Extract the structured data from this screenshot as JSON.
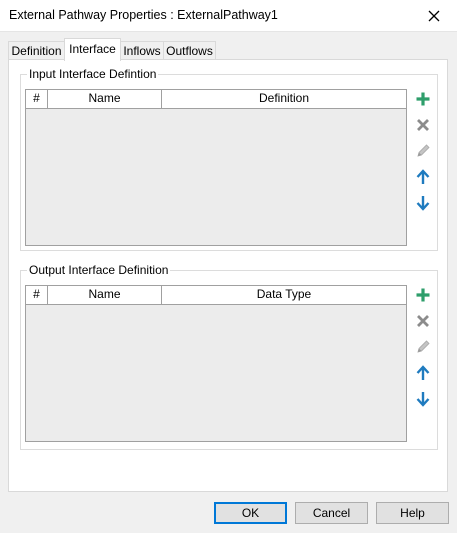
{
  "window": {
    "title": "External Pathway Properties : ExternalPathway1"
  },
  "tabs": [
    {
      "label": "Definition"
    },
    {
      "label": "Interface",
      "active": true
    },
    {
      "label": "Inflows"
    },
    {
      "label": "Outflows"
    }
  ],
  "input_group": {
    "legend": "Input Interface Defintion",
    "columns": [
      "#",
      "Name",
      "Definition"
    ],
    "rows": []
  },
  "output_group": {
    "legend": "Output Interface Definition",
    "columns": [
      "#",
      "Name",
      "Data Type"
    ],
    "rows": []
  },
  "side_buttons": {
    "icons": [
      "plus-icon",
      "delete-x-icon",
      "edit-pencil-icon",
      "arrow-up-icon",
      "arrow-down-icon"
    ],
    "colors": {
      "add": "#2e9e6b",
      "delete": "#8c8c8c",
      "edit": "#b0b0b0",
      "move": "#1f7bbf"
    }
  },
  "footer": {
    "ok_label": "OK",
    "cancel_label": "Cancel",
    "help_label": "Help"
  },
  "colors": {
    "accent": "#0078d7",
    "grid_bg": "#ececec"
  }
}
